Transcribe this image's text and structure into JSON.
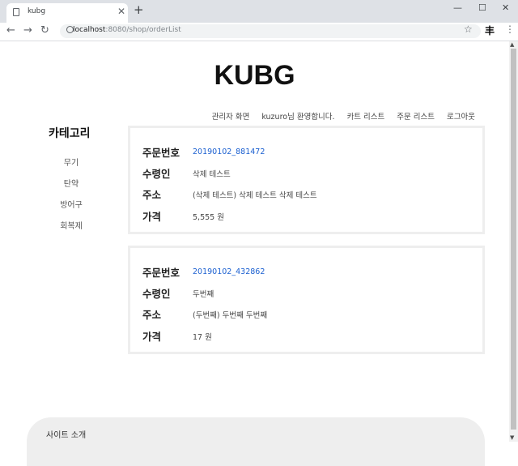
{
  "browser": {
    "tab_title": "kubg",
    "close_glyph": "✕",
    "newtab_glyph": "+",
    "url_host": "localhost",
    "url_path": ":8080/shop/orderList",
    "window_controls": {
      "minimize": "—",
      "maximize": "☐",
      "close": "✕"
    },
    "nav": {
      "back": "←",
      "forward": "→",
      "reload": "↻"
    },
    "star_glyph": "☆",
    "extension_glyph": "丰",
    "menu_glyph": "⋮"
  },
  "site": {
    "logo": "KUBG"
  },
  "topnav": [
    "관리자 화면",
    "kuzuro님 환영합니다.",
    "카트 리스트",
    "주문 리스트",
    "로그아웃"
  ],
  "sidebar": {
    "title": "카테고리",
    "items": [
      "무기",
      "탄약",
      "방어구",
      "회복제"
    ]
  },
  "labels": {
    "order_no": "주문번호",
    "recipient": "수령인",
    "address": "주소",
    "price": "가격"
  },
  "orders": [
    {
      "order_no": "20190102_881472",
      "recipient": "삭제 테스트",
      "address": "(삭제 테스트) 삭제 테스트 삭제 테스트",
      "price": "5,555 원"
    },
    {
      "order_no": "20190102_432862",
      "recipient": "두번째",
      "address": "(두번째) 두번째 두번째",
      "price": "17 원"
    }
  ],
  "footer": {
    "title": "사이트 소개"
  },
  "colors": {
    "link": "#1a5fd0",
    "card_border": "#eeeeee",
    "footer_bg": "#eeeeee"
  }
}
